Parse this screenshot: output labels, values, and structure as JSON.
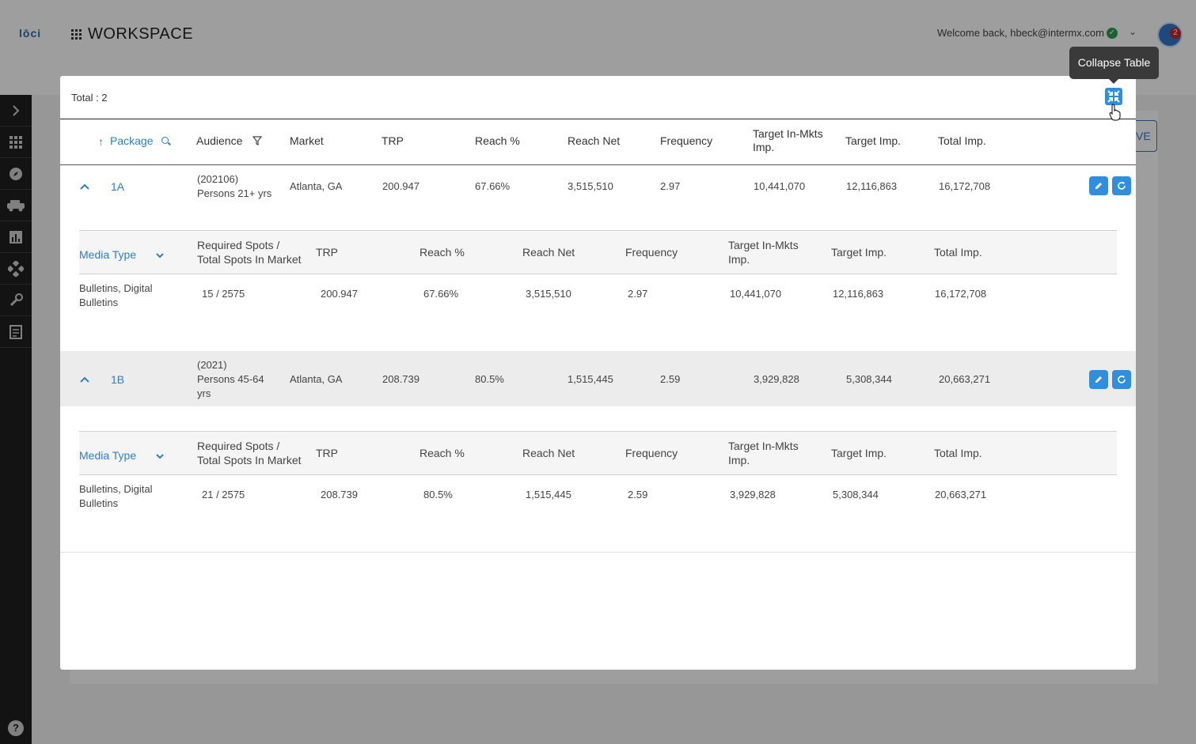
{
  "app": {
    "logo": "lōci",
    "title": "WORKSPACE",
    "welcome": "Welcome back, hbeck@intermx.com",
    "notification_count": "2",
    "bg_button_label": "VE",
    "help_label": "?"
  },
  "sidebar": {
    "items": [
      "chevron-right-icon",
      "grid-icon",
      "compass-icon",
      "vehicles-icon",
      "bar-chart-icon",
      "network-icon",
      "wrench-icon",
      "report-icon"
    ]
  },
  "modal": {
    "total": "Total : 2",
    "tooltip": "Collapse Table",
    "columns": {
      "package": "Package",
      "audience": "Audience",
      "market": "Market",
      "trp": "TRP",
      "reach_pct": "Reach %",
      "reach_net": "Reach Net",
      "frequency": "Frequency",
      "target_inmkts_1": "Target In-Mkts",
      "target_inmkts_2": "Imp.",
      "target_imp": "Target Imp.",
      "total_imp": "Total Imp."
    },
    "sub_columns": {
      "media_type": "Media Type",
      "required_1": "Required Spots /",
      "required_2": "Total Spots In Market",
      "trp": "TRP",
      "reach_pct": "Reach %",
      "reach_net": "Reach Net",
      "frequency": "Frequency",
      "target_inmkts_1": "Target In-Mkts",
      "target_inmkts_2": "Imp.",
      "target_imp": "Target Imp.",
      "total_imp": "Total Imp."
    },
    "packages": [
      {
        "package": "1A",
        "audience_1": "(202106)",
        "audience_2": "Persons 21+ yrs",
        "audience_3": "",
        "market": "Atlanta, GA",
        "trp": "200.947",
        "reach_pct": "67.66%",
        "reach_net": "3,515,510",
        "frequency": "2.97",
        "target_inmkts": "10,441,070",
        "target_imp": "12,116,863",
        "total_imp": "16,172,708",
        "sub": {
          "media_1": "Bulletins, Digital",
          "media_2": "Bulletins",
          "spots": "15 / 2575",
          "trp": "200.947",
          "reach_pct": "67.66%",
          "reach_net": "3,515,510",
          "frequency": "2.97",
          "target_inmkts": "10,441,070",
          "target_imp": "12,116,863",
          "total_imp": "16,172,708"
        }
      },
      {
        "package": "1B",
        "audience_1": "(2021)",
        "audience_2": "Persons 45-64",
        "audience_3": "yrs",
        "market": "Atlanta, GA",
        "trp": "208.739",
        "reach_pct": "80.5%",
        "reach_net": "1,515,445",
        "frequency": "2.59",
        "target_inmkts": "3,929,828",
        "target_imp": "5,308,344",
        "total_imp": "20,663,271",
        "sub": {
          "media_1": "Bulletins, Digital",
          "media_2": "Bulletins",
          "spots": "21 / 2575",
          "trp": "208.739",
          "reach_pct": "80.5%",
          "reach_net": "1,515,445",
          "frequency": "2.59",
          "target_inmkts": "3,929,828",
          "target_imp": "5,308,344",
          "total_imp": "20,663,271"
        }
      }
    ]
  },
  "colors": {
    "accent": "#2f8fde",
    "link": "#2a7fc9",
    "sidebar": "#1f1f1f",
    "tooltip": "#3a3a3a"
  }
}
